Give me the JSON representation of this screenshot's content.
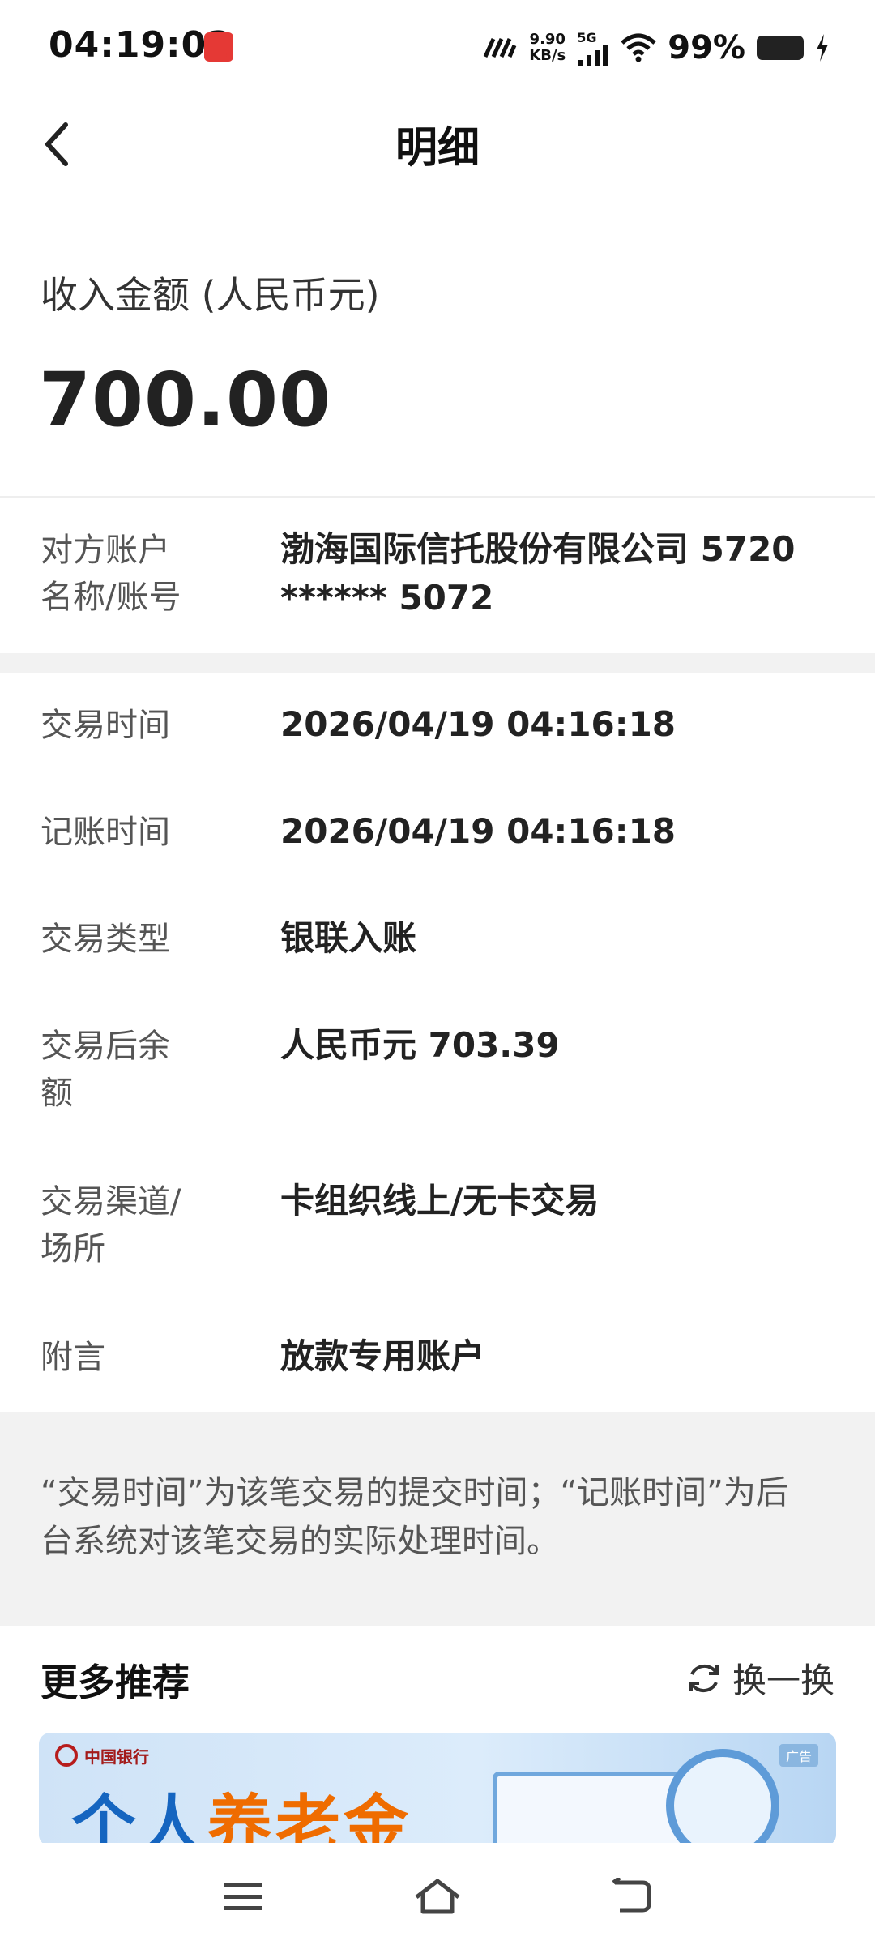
{
  "status": {
    "time": "04:19:03",
    "net_speed_value": "9.90",
    "net_speed_unit": "KB/s",
    "network": "5G",
    "battery": "99%"
  },
  "header": {
    "title": "明细"
  },
  "amount": {
    "label": "收入金额 (人民币元)",
    "value": "700.00"
  },
  "counterparty": {
    "label_line1": "对方账户",
    "label_line2": "名称/账号",
    "value_line1": "渤海国际信托股份有限公司 5720",
    "value_line2": "****** 5072"
  },
  "details": {
    "trade_time": {
      "label": "交易时间",
      "value": "2026/04/19 04:16:18"
    },
    "post_time": {
      "label": "记账时间",
      "value": "2026/04/19 04:16:18"
    },
    "trade_type": {
      "label": "交易类型",
      "value": "银联入账"
    },
    "balance": {
      "label_line1": "交易后余",
      "label_line2": "额",
      "value": "人民币元 703.39"
    },
    "channel": {
      "label_line1": "交易渠道/",
      "label_line2": "场所",
      "value": "卡组织线上/无卡交易"
    },
    "memo": {
      "label": "附言",
      "value": "放款专用账户"
    }
  },
  "notice": {
    "line1": "“交易时间”为该笔交易的提交时间；“记账时间”为后",
    "line2": "台系统对该笔交易的实际处理时间。"
  },
  "recommend": {
    "title": "更多推荐",
    "refresh_label": "换一换",
    "banner": {
      "bank_name": "中国银行",
      "headline_part1": "个人",
      "headline_part2": "养老金",
      "ad_tag": "广告"
    }
  },
  "colors": {
    "accent_blue": "#1565c0",
    "accent_orange": "#ef6c00",
    "bank_red": "#b71c1c"
  }
}
